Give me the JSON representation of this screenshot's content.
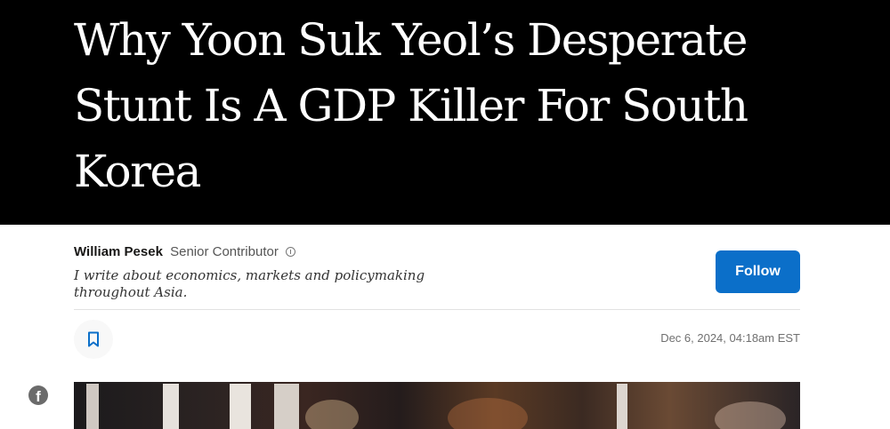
{
  "article": {
    "headline": "Why Yoon Suk Yeol’s Desperate Stunt Is A GDP Killer For South Korea"
  },
  "author": {
    "name": "William Pesek",
    "title": "Senior Contributor",
    "bio": "I write about economics, markets and policymaking throughout Asia.",
    "follow_label": "Follow"
  },
  "meta": {
    "timestamp": "Dec 6, 2024, 04:18am EST"
  },
  "icons": {
    "bookmark": "bookmark-icon",
    "info": "info-icon",
    "facebook": "facebook-icon"
  },
  "colors": {
    "hero_background": "#000000",
    "accent": "#0b6fc9",
    "facebook_icon": "#6b6b6b"
  }
}
